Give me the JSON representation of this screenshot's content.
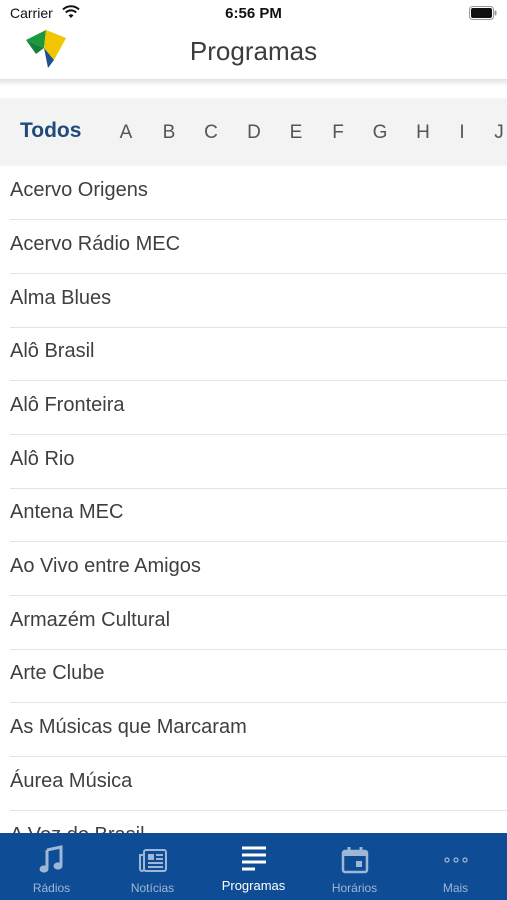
{
  "status_bar": {
    "carrier": "Carrier",
    "time": "6:56 PM"
  },
  "header": {
    "title": "Programas"
  },
  "alphabet": {
    "all_label": "Todos",
    "letters": [
      "A",
      "B",
      "C",
      "D",
      "E",
      "F",
      "G",
      "H",
      "I",
      "J"
    ]
  },
  "programs": [
    "Acervo Origens",
    "Acervo Rádio MEC",
    "Alma Blues",
    "Alô Brasil",
    "Alô Fronteira",
    "Alô Rio",
    "Antena MEC",
    "Ao Vivo entre Amigos",
    "Armazém Cultural",
    "Arte Clube",
    "As Músicas que Marcaram",
    "Áurea Música",
    "A Voz do Brasil"
  ],
  "tabs": [
    {
      "label": "Rádios",
      "icon": "music-note-icon"
    },
    {
      "label": "Notícias",
      "icon": "newspaper-icon"
    },
    {
      "label": "Programas",
      "icon": "list-icon",
      "active": true
    },
    {
      "label": "Horários",
      "icon": "calendar-icon"
    },
    {
      "label": "Mais",
      "icon": "more-dots-icon"
    }
  ],
  "colors": {
    "tab_bar": "#0e4c95",
    "accent_todos": "#214a7c",
    "logo_green": "#1a9a3a",
    "logo_yellow": "#f2c500",
    "logo_blue": "#1d4f91"
  }
}
